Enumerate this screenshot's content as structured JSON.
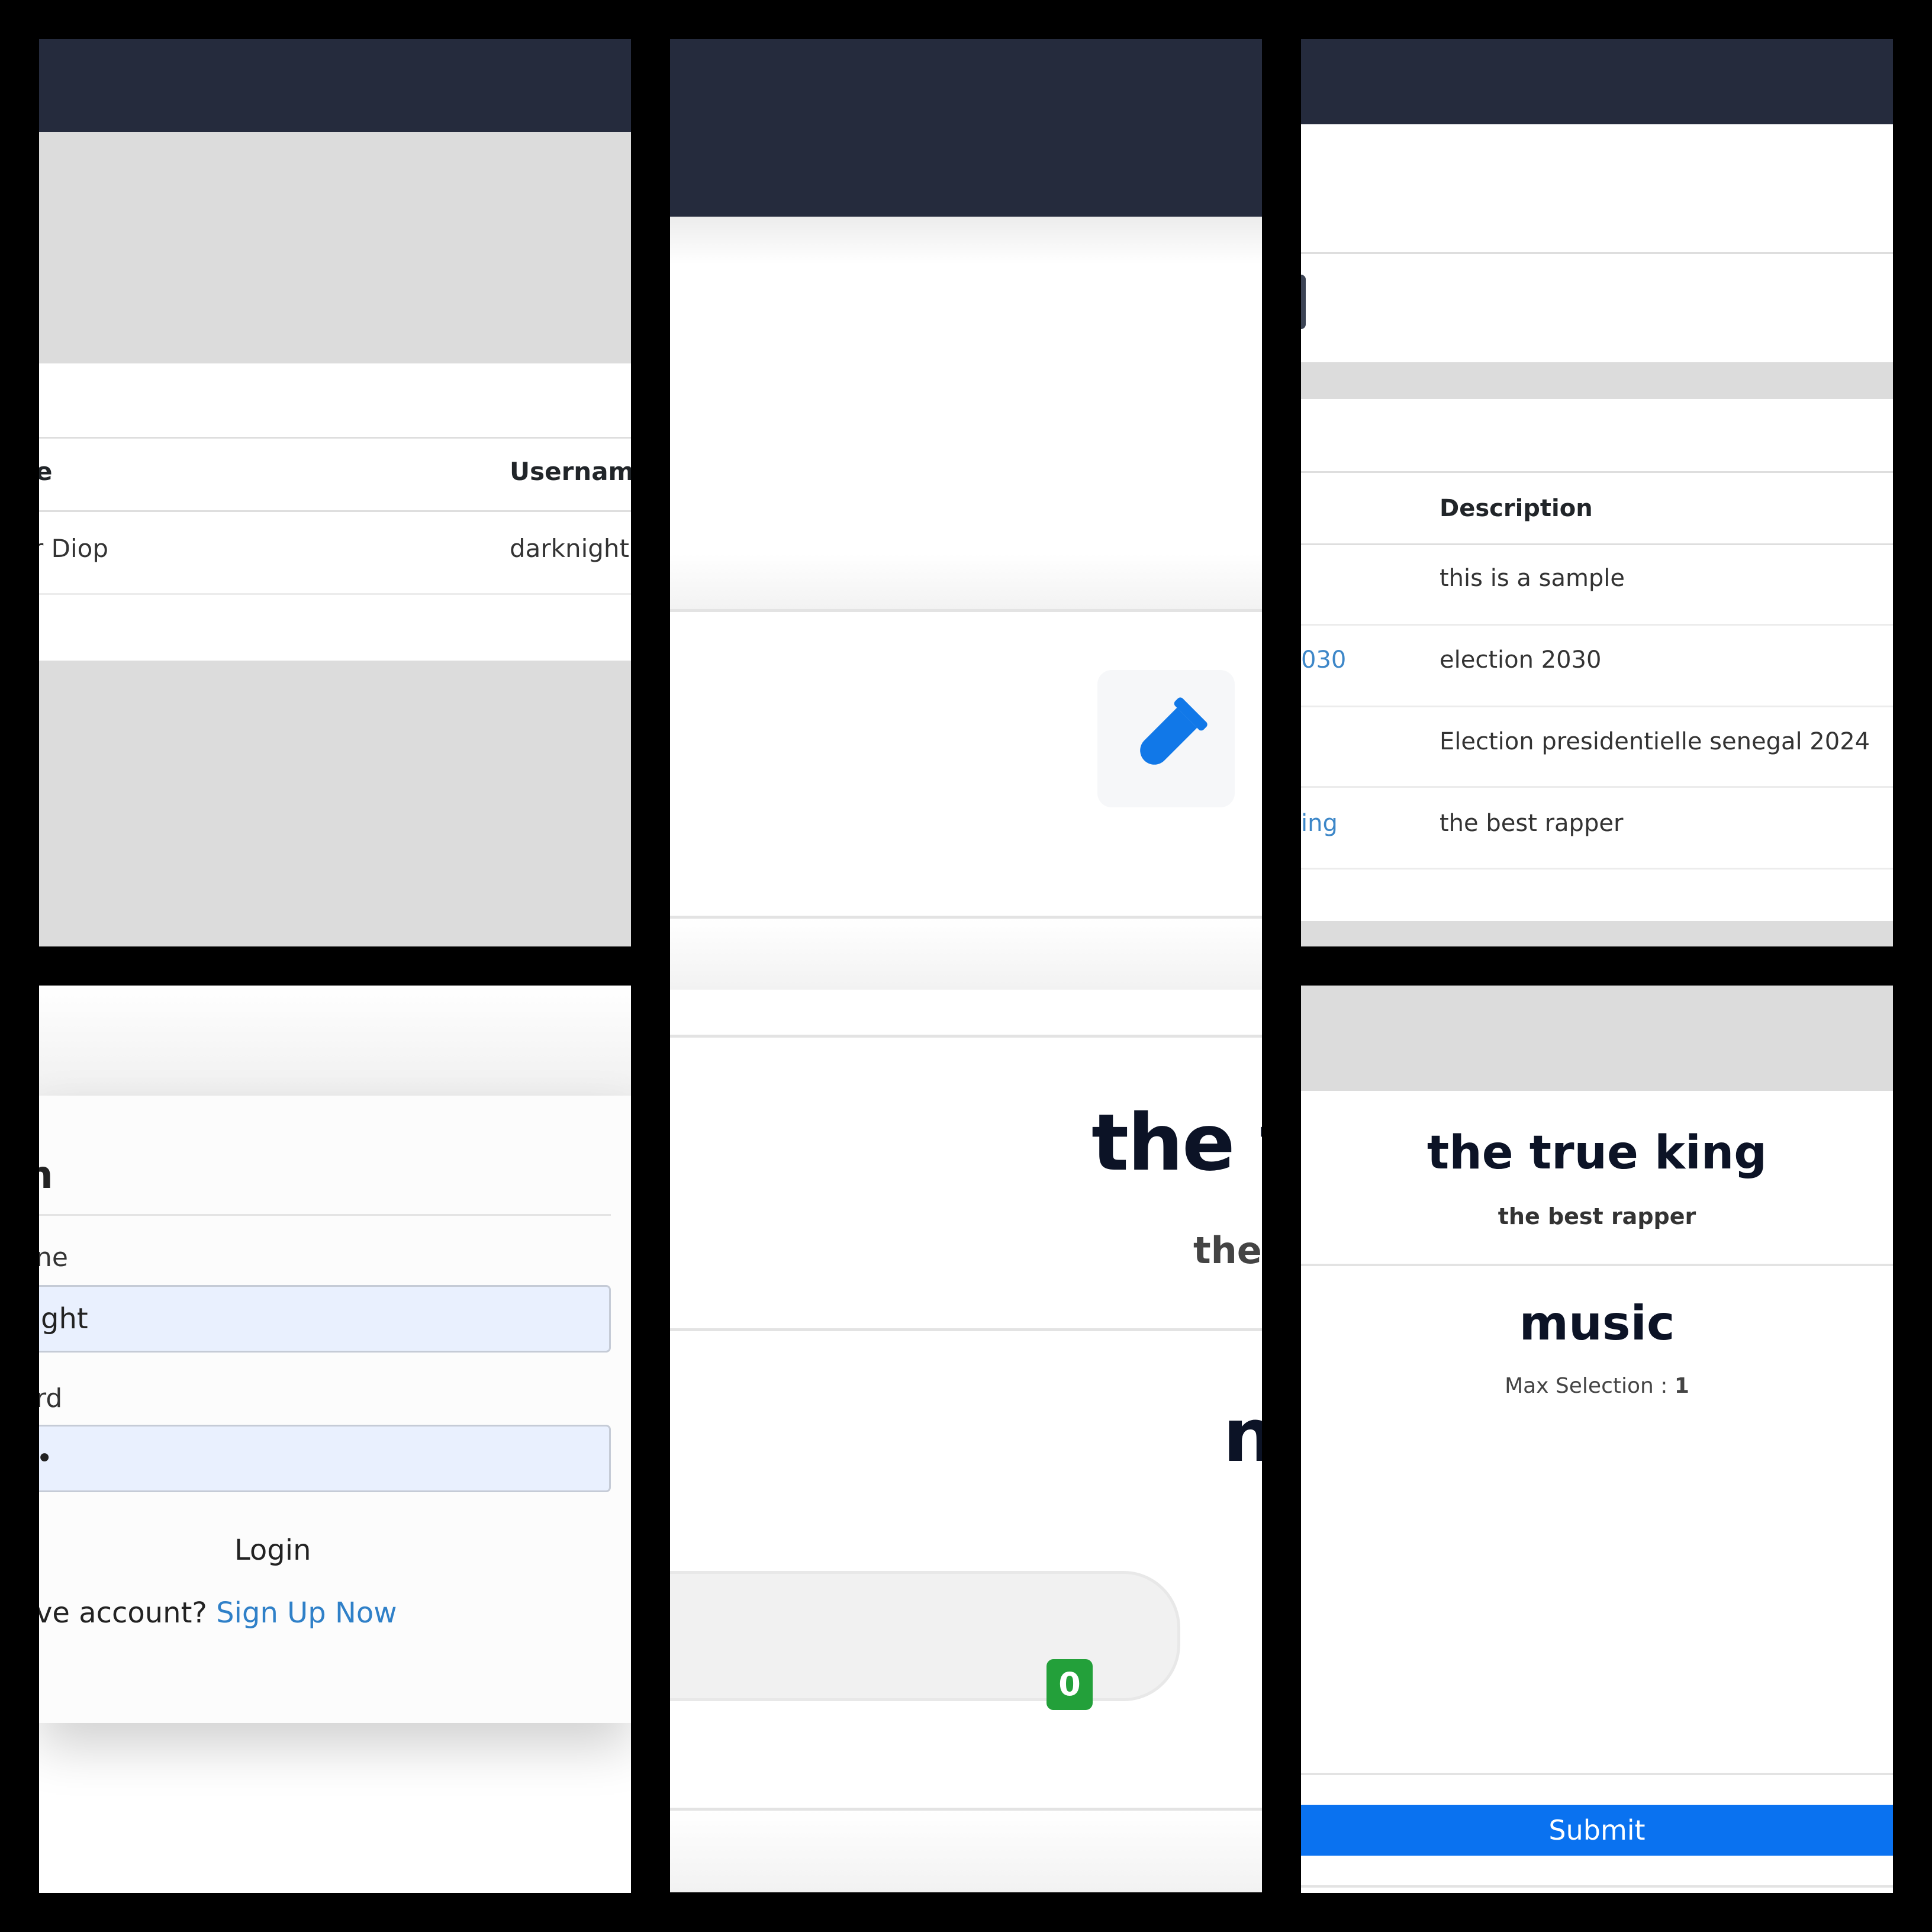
{
  "users_table": {
    "header_name_fragment": "e",
    "header_username": "Username",
    "row_name_fragment": "r Diop",
    "row_username": "darknight"
  },
  "election_card": {
    "title_fragment": "the t",
    "subtitle_fragment": "the",
    "category_fragment": "n",
    "vote_count": "0"
  },
  "elections_table": {
    "header_description": "Description",
    "rows": [
      {
        "title_fragment": "",
        "description": "this is a sample"
      },
      {
        "title_fragment": "030",
        "description": "election 2030"
      },
      {
        "title_fragment": "",
        "description": "Election presidentielle senegal 2024"
      },
      {
        "title_fragment": "ing",
        "description": "the best rapper"
      }
    ]
  },
  "login": {
    "title_fragment": "n",
    "username_label_fragment": "ne",
    "username_value_fragment": "ght",
    "password_label_fragment": "rd",
    "password_value_fragment": "•",
    "login_button": "Login",
    "signup_prompt_fragment": "ve account?",
    "signup_link": "Sign Up Now"
  },
  "ballot": {
    "election_title": "the true king",
    "election_description": "the best rapper",
    "position_title": "music",
    "max_selection_label": "Max Selection :",
    "max_selection_value": "1",
    "submit_button": "Submit"
  },
  "colors": {
    "navbar": "#252b3d",
    "accent_blue": "#0a72f0",
    "link_blue": "#3d87c8",
    "badge_green": "#23a03a"
  }
}
